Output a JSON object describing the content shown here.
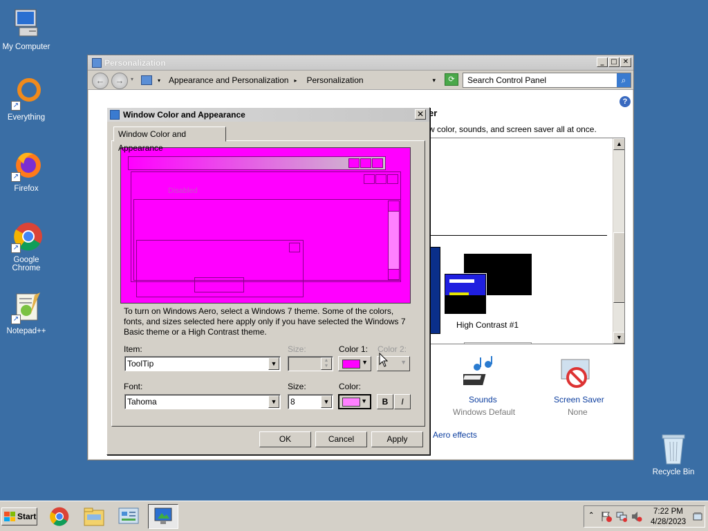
{
  "desktop": {
    "icons": [
      {
        "label": "My Computer",
        "icon": "computer-icon"
      },
      {
        "label": "Everything",
        "icon": "everything-icon"
      },
      {
        "label": "Firefox",
        "icon": "firefox-icon"
      },
      {
        "label": "Google Chrome",
        "icon": "chrome-icon"
      },
      {
        "label": "Notepad++",
        "icon": "notepad-plus-plus-icon"
      }
    ],
    "recycle_bin": "Recycle Bin"
  },
  "cp_window": {
    "title": "Personalization",
    "breadcrumb": [
      "Appearance and Personalization",
      "Personalization"
    ],
    "search_placeholder": "Search Control Panel",
    "heading_fragment": "er",
    "subtitle_fragment": "w color, sounds, and screen saver all at once.",
    "theme_label": "High Contrast #1",
    "sounds_label": "Sounds",
    "sounds_value": "Windows Default",
    "screensaver_label": "Screen Saver",
    "screensaver_value": "None",
    "aero_link": "Aero effects"
  },
  "dialog": {
    "title": "Window Color and Appearance",
    "tab_label": "Window Color and Appearance",
    "preview_disabled": "Disabled",
    "info_text": "To turn on Windows Aero, select a Windows 7 theme.  Some of the colors, fonts, and sizes selected here apply only if you have selected the Windows 7 Basic theme or a High Contrast theme.",
    "item_label": "Item:",
    "item_value": "ToolTip",
    "size_label": "Size:",
    "color1_label": "Color 1:",
    "color2_label": "Color 2:",
    "font_label": "Font:",
    "font_value": "Tahoma",
    "font_size_label": "Size:",
    "font_size_value": "8",
    "font_color_label": "Color:",
    "bold_label": "B",
    "italic_label": "I",
    "ok_label": "OK",
    "cancel_label": "Cancel",
    "apply_label": "Apply",
    "colors": {
      "preview_bg": "#ff00ff",
      "color1": "#ff00ff",
      "font_color": "#ff80ff"
    }
  },
  "taskbar": {
    "start_label": "Start",
    "time": "7:22 PM",
    "date": "4/28/2023"
  }
}
